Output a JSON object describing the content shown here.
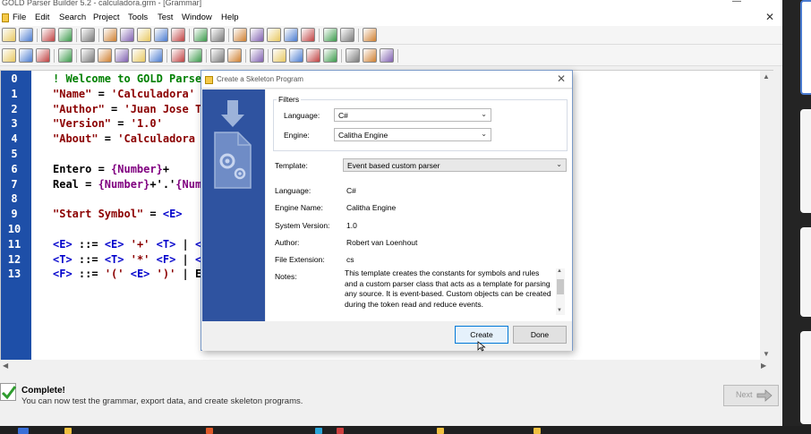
{
  "app": {
    "title": "GOLD Parser Builder 5.2 - calculadora.grm - [Grammar]",
    "minimize_glyph": "—",
    "close_glyph": "✕"
  },
  "menu": {
    "items": [
      "File",
      "Edit",
      "Search",
      "Project",
      "Tools",
      "Test",
      "Window",
      "Help"
    ]
  },
  "toolbar1": {
    "icons": [
      "new-icon",
      "open-icon",
      "save-icon",
      "print-icon",
      "cut-icon",
      "copy-icon",
      "paste-icon",
      "delete-icon",
      "undo-icon",
      "redo-icon",
      "indent-left-icon",
      "indent-right-icon",
      "outdent-icon",
      "comment-icon",
      "uncomment-icon",
      "find-icon",
      "find-next-icon",
      "replace-icon",
      "help-icon",
      "home-icon"
    ]
  },
  "toolbar2": {
    "icons": [
      "step-icon",
      "export-icon",
      "enter-icon",
      "clear-icon",
      "table-icon",
      "tree-icon",
      "text-icon",
      "set-icon",
      "prod-icon",
      "symbol-icon",
      "check-icon",
      "lalr-icon",
      "dfa-icon",
      "save-tables-icon",
      "play-icon",
      "step-forward-icon",
      "pause-icon",
      "stop-icon",
      "test-icon",
      "test-tree-icon",
      "options-icon"
    ]
  },
  "editor": {
    "line_numbers": [
      "0",
      "1",
      "2",
      "3",
      "4",
      "5",
      "6",
      "7",
      "8",
      "9",
      "10",
      "11",
      "12",
      "13"
    ],
    "lines": [
      [
        {
          "t": "! Welcome to GOLD Parser",
          "c": "comment"
        }
      ],
      [
        {
          "t": "\"Name\"",
          "c": "string"
        },
        {
          "t": " = ",
          "c": "plain"
        },
        {
          "t": "'Calculadora'",
          "c": "string"
        }
      ],
      [
        {
          "t": "\"Author\"",
          "c": "string"
        },
        {
          "t": " = ",
          "c": "plain"
        },
        {
          "t": "'Juan Jose Te",
          "c": "string"
        }
      ],
      [
        {
          "t": "\"Version\"",
          "c": "string"
        },
        {
          "t": " = ",
          "c": "plain"
        },
        {
          "t": "'1.0'",
          "c": "string"
        }
      ],
      [
        {
          "t": "\"About\"",
          "c": "string"
        },
        {
          "t": " = ",
          "c": "plain"
        },
        {
          "t": "'Calculadora q",
          "c": "string"
        }
      ],
      [],
      [
        {
          "t": "Entero = ",
          "c": "plain"
        },
        {
          "t": "{Number}",
          "c": "set"
        },
        {
          "t": "+",
          "c": "plain"
        }
      ],
      [
        {
          "t": "Real = ",
          "c": "plain"
        },
        {
          "t": "{Number}",
          "c": "set"
        },
        {
          "t": "+'.'",
          "c": "plain"
        },
        {
          "t": "{Numb",
          "c": "set"
        }
      ],
      [],
      [
        {
          "t": "\"Start Symbol\"",
          "c": "string"
        },
        {
          "t": " = ",
          "c": "plain"
        },
        {
          "t": "<E>",
          "c": "nt"
        }
      ],
      [],
      [
        {
          "t": "<E>",
          "c": "nt"
        },
        {
          "t": " ::= ",
          "c": "plain"
        },
        {
          "t": "<E>",
          "c": "nt"
        },
        {
          "t": " '+' ",
          "c": "string"
        },
        {
          "t": "<T>",
          "c": "nt"
        },
        {
          "t": " | ",
          "c": "plain"
        },
        {
          "t": "<E",
          "c": "nt"
        }
      ],
      [
        {
          "t": "<T>",
          "c": "nt"
        },
        {
          "t": " ::= ",
          "c": "plain"
        },
        {
          "t": "<T>",
          "c": "nt"
        },
        {
          "t": " '*' ",
          "c": "string"
        },
        {
          "t": "<F>",
          "c": "nt"
        },
        {
          "t": " | ",
          "c": "plain"
        },
        {
          "t": "<T",
          "c": "nt"
        }
      ],
      [
        {
          "t": "<F>",
          "c": "nt"
        },
        {
          "t": " ::= ",
          "c": "plain"
        },
        {
          "t": "'(' ",
          "c": "string"
        },
        {
          "t": "<E>",
          "c": "nt"
        },
        {
          "t": " ')' ",
          "c": "string"
        },
        {
          "t": "| En",
          "c": "plain"
        }
      ]
    ]
  },
  "status": {
    "title": "Complete!",
    "message": "You can now test the grammar, export data, and create skeleton programs.",
    "next_label": "Next"
  },
  "dialog": {
    "title": "Create a Skeleton Program",
    "close_glyph": "✕",
    "filters_label": "Filters",
    "language_label": "Language:",
    "language_value": "C#",
    "engine_label": "Engine:",
    "engine_value": "Calitha Engine",
    "template_label": "Template:",
    "template_value": "Event based custom parser",
    "info": [
      {
        "label": "Language:",
        "value": "C#"
      },
      {
        "label": "Engine Name:",
        "value": "Calitha Engine"
      },
      {
        "label": "System Version:",
        "value": "1.0"
      },
      {
        "label": "Author:",
        "value": "Robert van Loenhout"
      },
      {
        "label": "File Extension:",
        "value": "cs"
      }
    ],
    "notes_label": "Notes:",
    "notes_text": "This template creates the constants for symbols and rules and a custom parser class that acts as a template for parsing any source. It is event-based. Custom objects can be created during the token read and reduce events.",
    "create_label": "Create",
    "done_label": "Done"
  },
  "colors": {
    "gutter": "#1e4fa8",
    "banner": "#2f53a0",
    "comment": "#008000",
    "string": "#8b0000",
    "set": "#800080",
    "nonterminal": "#0000cc",
    "focus_border": "#0078d7"
  }
}
